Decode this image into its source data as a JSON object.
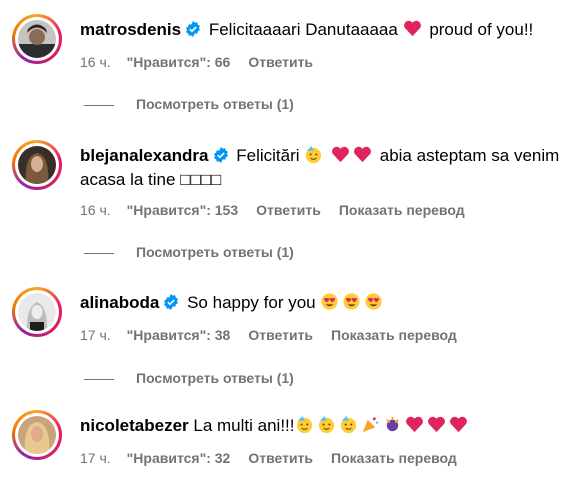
{
  "comments": [
    {
      "username": "matrosdenis",
      "verified": true,
      "text": "Felicitaaaari Danutaaaaa",
      "text_after": "proud of you!!",
      "time": "16 ч.",
      "likes": "\"Нравится\": 66",
      "reply": "Ответить",
      "translate": "",
      "view_replies": "Посмотреть ответы (1)"
    },
    {
      "username": "blejanalexandra",
      "verified": true,
      "text": "Felicitări",
      "text_after": "abia asteptam sa venim",
      "text_line2": "acasa la tine □□□□",
      "time": "16 ч.",
      "likes": "\"Нравится\": 153",
      "reply": "Ответить",
      "translate": "Показать перевод",
      "view_replies": "Посмотреть ответы (1)"
    },
    {
      "username": "alinaboda",
      "verified": true,
      "text": "So happy for you",
      "time": "17 ч.",
      "likes": "\"Нравится\": 38",
      "reply": "Ответить",
      "translate": "Показать перевод",
      "view_replies": "Посмотреть ответы (1)"
    },
    {
      "username": "nicoletabezer",
      "verified": false,
      "text": "La multi ani!!!",
      "time": "17 ч.",
      "likes": "\"Нравится\": 32",
      "reply": "Ответить",
      "translate": "Показать перевод"
    }
  ],
  "colors": {
    "verified": "#0095f6",
    "heart": "#e0245e",
    "meta": "#737373",
    "emoji": "#ffcc33"
  },
  "icons": {
    "verified": "verified-badge-icon",
    "heart": "red-heart-emoji",
    "smile_eyes": "heart-eyes-emoji",
    "party": "partying-face-emoji",
    "confetti": "party-popper-emoji",
    "sparkle_gift": "confetti-emoji"
  }
}
